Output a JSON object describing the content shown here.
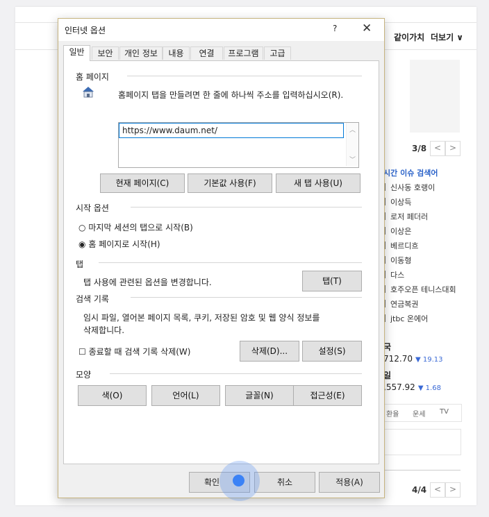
{
  "browser": {
    "nav": [
      "같이가치",
      "더보기 ∨"
    ],
    "pager_top": "3/8",
    "pager_bottom": "4/4",
    "prev": "<",
    "next": ">",
    "issue_title": "시간 이슈 검색어",
    "issues": [
      "신사동 호랭이",
      "이상득",
      "로저 페더러",
      "이상은",
      "베르디흐",
      "이동형",
      "다스",
      "호주오픈 테니스대회",
      "연금복권",
      "jtbc 온에어"
    ],
    "stocks": [
      {
        "name": "국",
        "value": "712.70",
        "change": "▼ 19.13"
      },
      {
        "name": "일",
        "value": ",557.92",
        "change": "▼ 1.68"
      }
    ],
    "tabs": [
      "환율",
      "운세",
      "TV"
    ]
  },
  "dialog": {
    "title": "인터넷 옵션",
    "help": "?",
    "close": "✕",
    "tabs": [
      "일반",
      "보안",
      "개인 정보",
      "내용",
      "연결",
      "프로그램",
      "고급"
    ],
    "home": {
      "heading": "홈 페이지",
      "instruction": "홈페이지 탭을 만들려면 한 줄에 하나씩 주소를 입력하십시오(R).",
      "url": "https://www.daum.net/",
      "btn_current": "현재 페이지(C)",
      "btn_default": "기본값 사용(F)",
      "btn_newtab": "새 탭 사용(U)"
    },
    "startup": {
      "heading": "시작 옵션",
      "option1": "마지막 세션의 탭으로 시작(B)",
      "option2": "홈 페이지로 시작(H)"
    },
    "tabs_section": {
      "heading": "탭",
      "desc": "탭 사용에 관련된 옵션을 변경합니다.",
      "btn": "탭(T)"
    },
    "history": {
      "heading": "검색 기록",
      "desc1": "임시 파일, 열어본 페이지 목록, 쿠키, 저장된 암호 및 웹 양식 정보를",
      "desc2": "삭제합니다.",
      "checkbox": "종료할 때 검색 기록 삭제(W)",
      "btn_delete": "삭제(D)...",
      "btn_settings": "설정(S)"
    },
    "appearance": {
      "heading": "모양",
      "btn_color": "색(O)",
      "btn_lang": "언어(L)",
      "btn_font": "글꼴(N)",
      "btn_access": "접근성(E)"
    },
    "footer": {
      "ok": "확인",
      "cancel": "취소",
      "apply": "적용(A)"
    }
  },
  "colors": {
    "accent": "#0078d7",
    "click_marker": "#3b82f6",
    "link_blue": "#2a62c9"
  }
}
